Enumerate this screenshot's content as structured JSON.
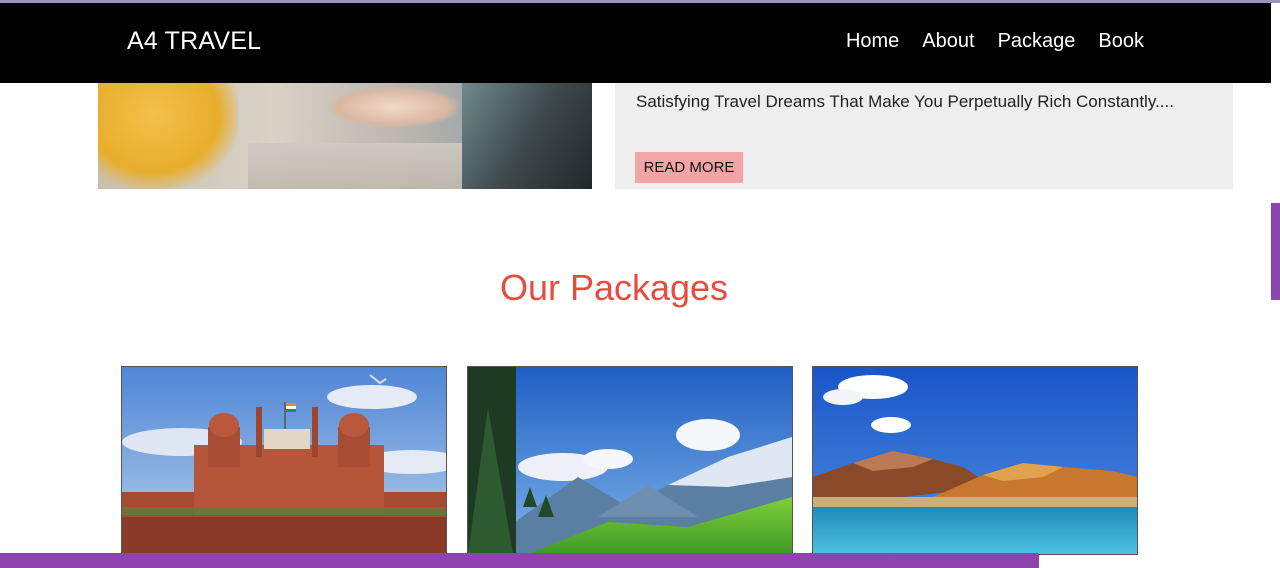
{
  "brand": "A4 TRAVEL",
  "nav": [
    "Home",
    "About",
    "Package",
    "Book"
  ],
  "hero": {
    "text": "Satisfying Travel Dreams That Make You Perpetually Rich Constantly....",
    "button": "READ MORE"
  },
  "packages_section": {
    "title": "Our Packages",
    "images": [
      "red-fort-image",
      "mountain-valley-image",
      "lake-mountains-image"
    ]
  },
  "colors": {
    "navbar": "#000000",
    "title": "#e84c3d",
    "button": "#f3a5a5",
    "card_bg": "#eeeeee",
    "accent": "#8e44ad"
  }
}
